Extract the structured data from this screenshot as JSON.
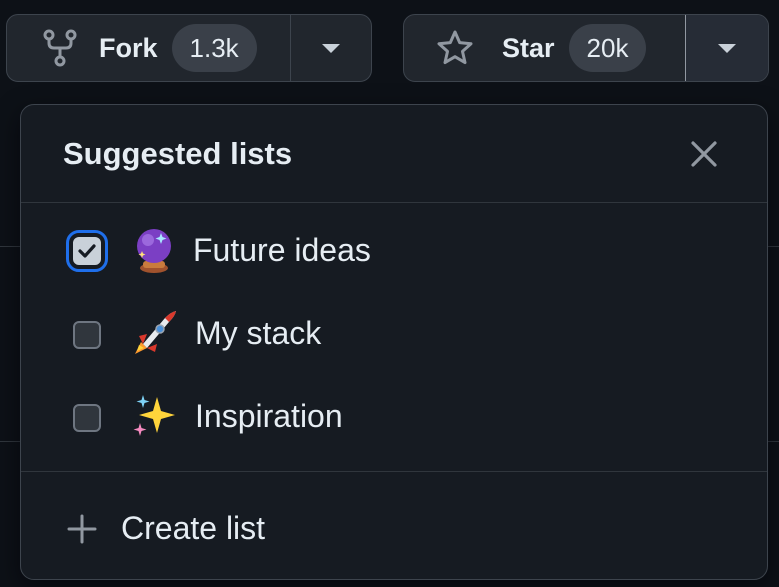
{
  "fork_button": {
    "label": "Fork",
    "count": "1.3k",
    "icon": "repo-forked-icon"
  },
  "star_button": {
    "label": "Star",
    "count": "20k",
    "icon": "star-icon"
  },
  "lists_popover": {
    "title": "Suggested lists",
    "close_icon": "x-icon",
    "items": [
      {
        "label": "Future ideas",
        "emoji": "crystal-ball-icon",
        "checked": true
      },
      {
        "label": "My stack",
        "emoji": "rocket-icon",
        "checked": false
      },
      {
        "label": "Inspiration",
        "emoji": "sparkles-icon",
        "checked": false
      }
    ],
    "create_label": "Create list",
    "create_icon": "plus-icon"
  },
  "colors": {
    "page_bg": "#0d1117",
    "popover_bg": "#161b22",
    "button_bg": "#21262d",
    "border": "#3d444d",
    "text": "#e6edf3",
    "focus_ring": "#1f6feb"
  }
}
